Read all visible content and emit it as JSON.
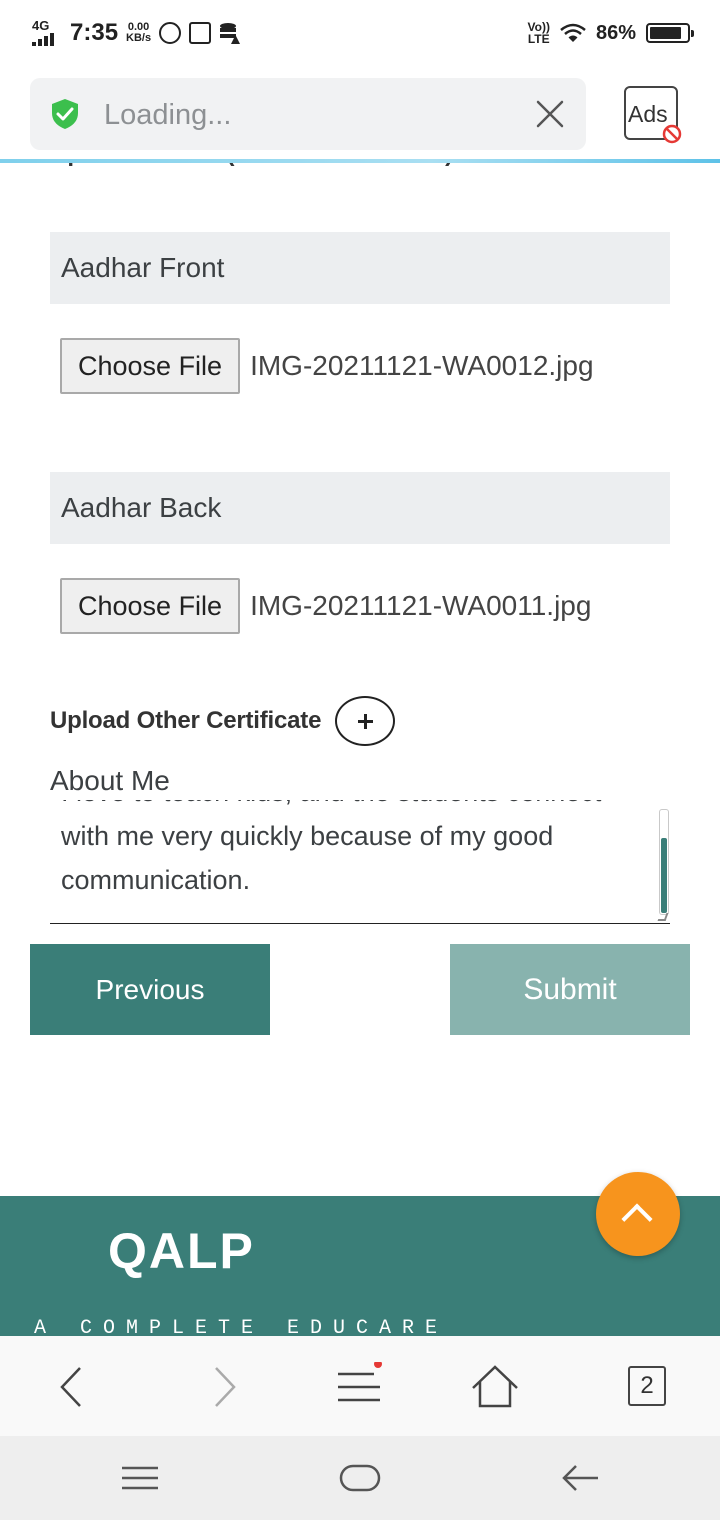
{
  "status_bar": {
    "network": "4G",
    "time": "7:35",
    "speed_value": "0.00",
    "speed_unit": "KB/s",
    "volte_top": "Vo))",
    "volte_bottom": "LTE",
    "battery": "86%",
    "battery_level": 0.86
  },
  "browser": {
    "url_text": "Loading...",
    "ads_label": "Ads"
  },
  "form": {
    "clipped_heading": "Upload Aadhar (Both Front & Back)",
    "aadhar_front_label": "Aadhar Front",
    "aadhar_back_label": "Aadhar Back",
    "choose_file_label": "Choose File",
    "front_file": "IMG-20211121-WA0012.jpg",
    "back_file": "IMG-20211121-WA0011.jpg",
    "other_certificate_label": "Upload Other Certificate",
    "about_label": "About Me",
    "about_text": "I love to teach kids, and the students connect with me very quickly because of my good communication.",
    "previous_label": "Previous",
    "submit_label": "Submit"
  },
  "footer": {
    "logo": "QALP",
    "tagline": "A COMPLETE EDUCARE"
  },
  "toolbar": {
    "tabs_count": "2"
  },
  "colors": {
    "brand": "#3a7e78",
    "submit_disabled": "#88b3ae",
    "scroll_top": "#f7941d"
  }
}
